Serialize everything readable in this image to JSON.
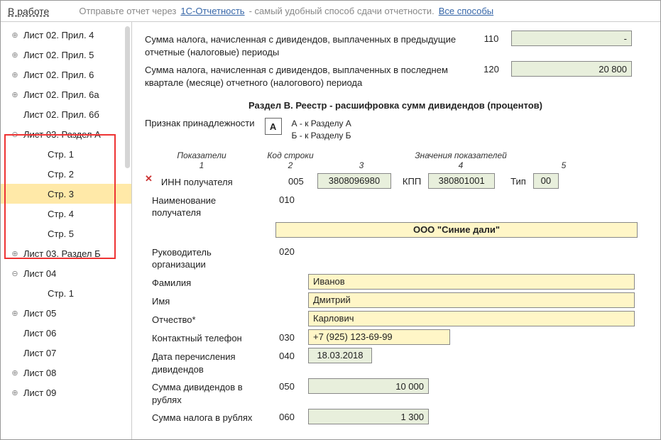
{
  "topbar": {
    "status": "В работе",
    "msg1": "Отправьте отчет через",
    "link1": "1С-Отчетность",
    "msg2": "- самый удобный способ сдачи отчетности.",
    "link2": "Все способы"
  },
  "tree": [
    {
      "label": "Лист 02. Прил. 4",
      "exp": "⊕",
      "lvl": 1
    },
    {
      "label": "Лист 02. Прил. 5",
      "exp": "⊕",
      "lvl": 1
    },
    {
      "label": "Лист 02. Прил. 6",
      "exp": "⊕",
      "lvl": 1
    },
    {
      "label": "Лист 02. Прил. 6а",
      "exp": "⊕",
      "lvl": 1
    },
    {
      "label": "Лист 02. Прил. 6б",
      "exp": "",
      "lvl": 1
    },
    {
      "label": "Лист 03. Раздел А",
      "exp": "⊖",
      "lvl": 1
    },
    {
      "label": "Стр. 1",
      "exp": "",
      "lvl": 2
    },
    {
      "label": "Стр. 2",
      "exp": "",
      "lvl": 2
    },
    {
      "label": "Стр. 3",
      "exp": "",
      "lvl": 2,
      "sel": true
    },
    {
      "label": "Стр. 4",
      "exp": "",
      "lvl": 2
    },
    {
      "label": "Стр. 5",
      "exp": "",
      "lvl": 2
    },
    {
      "label": "Лист 03. Раздел Б",
      "exp": "⊕",
      "lvl": 1
    },
    {
      "label": "Лист 04",
      "exp": "⊖",
      "lvl": 1
    },
    {
      "label": "Стр. 1",
      "exp": "",
      "lvl": 2
    },
    {
      "label": "Лист 05",
      "exp": "⊕",
      "lvl": 1
    },
    {
      "label": "Лист 06",
      "exp": "",
      "lvl": 1
    },
    {
      "label": "Лист 07",
      "exp": "",
      "lvl": 1
    },
    {
      "label": "Лист 08",
      "exp": "⊕",
      "lvl": 1
    },
    {
      "label": "Лист 09",
      "exp": "⊕",
      "lvl": 1
    }
  ],
  "r110": {
    "label": "Сумма налога, начисленная с дивидендов, выплаченных в предыдущие отчетные (налоговые) периоды",
    "code": "110",
    "val": "-"
  },
  "r120": {
    "label": "Сумма налога, начисленная с дивидендов, выплаченных в последнем квартале (месяце) отчетного (налогового) периода",
    "code": "120",
    "val": "20 800"
  },
  "sectionB": {
    "title": "Раздел В. Реестр - расшифровка сумм дивидендов (процентов)"
  },
  "priz": {
    "label": "Признак принадлежности",
    "val": "А",
    "a": "А - к Разделу А",
    "b": "Б - к Разделу Б"
  },
  "head": {
    "c1": "Показатели",
    "c1n": "1",
    "c2": "Код строки",
    "c2n": "2",
    "c3": "3",
    "mid": "Значения показателей",
    "c4": "4",
    "c5": "5"
  },
  "r005": {
    "label": "ИНН получателя",
    "code": "005",
    "inn": "3808096980",
    "kpp_l": "КПП",
    "kpp": "380801001",
    "tip_l": "Тип",
    "tip": "00"
  },
  "r010": {
    "label": "Наименование получателя",
    "code": "010",
    "org": "ООО \"Синие дали\""
  },
  "r020": {
    "label": "Руководитель организации",
    "code": "020"
  },
  "fio": {
    "f_l": "Фамилия",
    "f": "Иванов",
    "i_l": "Имя",
    "i": "Дмитрий",
    "o_l": "Отчество*",
    "o": "Карлович"
  },
  "r030": {
    "label": "Контактный телефон",
    "code": "030",
    "val": "+7 (925) 123-69-99"
  },
  "r040": {
    "label": "Дата перечисления дивидендов",
    "code": "040",
    "val": "18.03.2018"
  },
  "r050": {
    "label": "Сумма дивидендов в рублях",
    "code": "050",
    "val": "10 000"
  },
  "r060": {
    "label": "Сумма налога в рублях",
    "code": "060",
    "val": "1 300"
  }
}
